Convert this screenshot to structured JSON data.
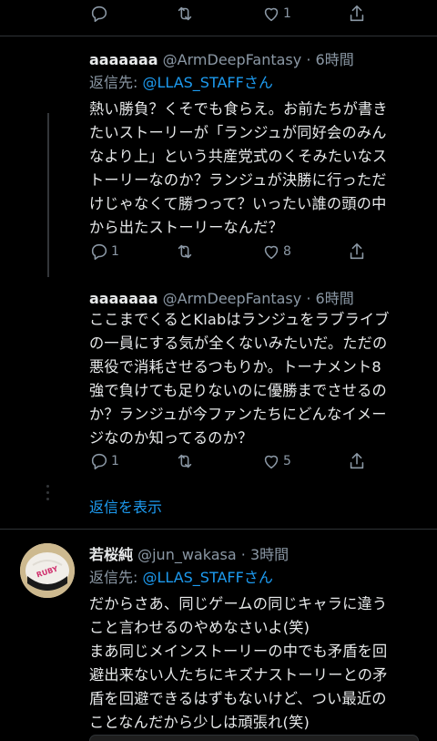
{
  "top_actions": {
    "like_count": "1"
  },
  "tweet1": {
    "name": "aaaaaaa",
    "handle": "@ArmDeepFantasy",
    "time": "6時間",
    "replying_label": "返信先:",
    "replying_handle": "@LLAS_STAFFさん",
    "lines": [
      "熱い勝負？くそでも食らえ。お前たちが書き",
      "たいストーリーが「ランジュが同好会のみん",
      "なより上」という共産党式のくそみたいなス",
      "トーリーなのか？ランジュが決勝に行っただ",
      "けじゃなくて勝つって？いったい誰の頭の中",
      "から出たストーリーなんだ？"
    ],
    "reply_count": "1",
    "like_count": "8"
  },
  "tweet2": {
    "name": "aaaaaaa",
    "handle": "@ArmDeepFantasy",
    "time": "6時間",
    "lines": [
      "ここまでくるとKlabはランジュをラブライブ",
      "の一員にする気が全くないみたいだ。ただの",
      "悪役で消耗させるつもりか。トーナメント8",
      "強で負けても足りないのに優勝までさせるの",
      "か？ランジュが今ファンたちにどんなイメー",
      "ジなのか知ってるのか？"
    ],
    "reply_count": "1",
    "like_count": "5"
  },
  "show_replies": "返信を表示",
  "tweet3": {
    "name": "若桜純",
    "handle": "@jun_wakasa",
    "time": "3時間",
    "replying_label": "返信先:",
    "replying_handle": "@LLAS_STAFFさん",
    "lines": [
      "だからさあ、同じゲームの同じキャラに違う",
      "こと言わせるのやめなさいよ(笑)",
      "まあ同じメインストーリーの中でも矛盾を回",
      "避出来ない人たちにキズナストーリーとの矛",
      "盾を回避できるはずもないけど、つい最近の",
      "ことなんだから少しは頑張れ(笑)"
    ],
    "avatar_text": "RUBY",
    "colors": {
      "link": "#1d9bf0",
      "muted": "#8b98a5",
      "background": "#000000"
    }
  }
}
